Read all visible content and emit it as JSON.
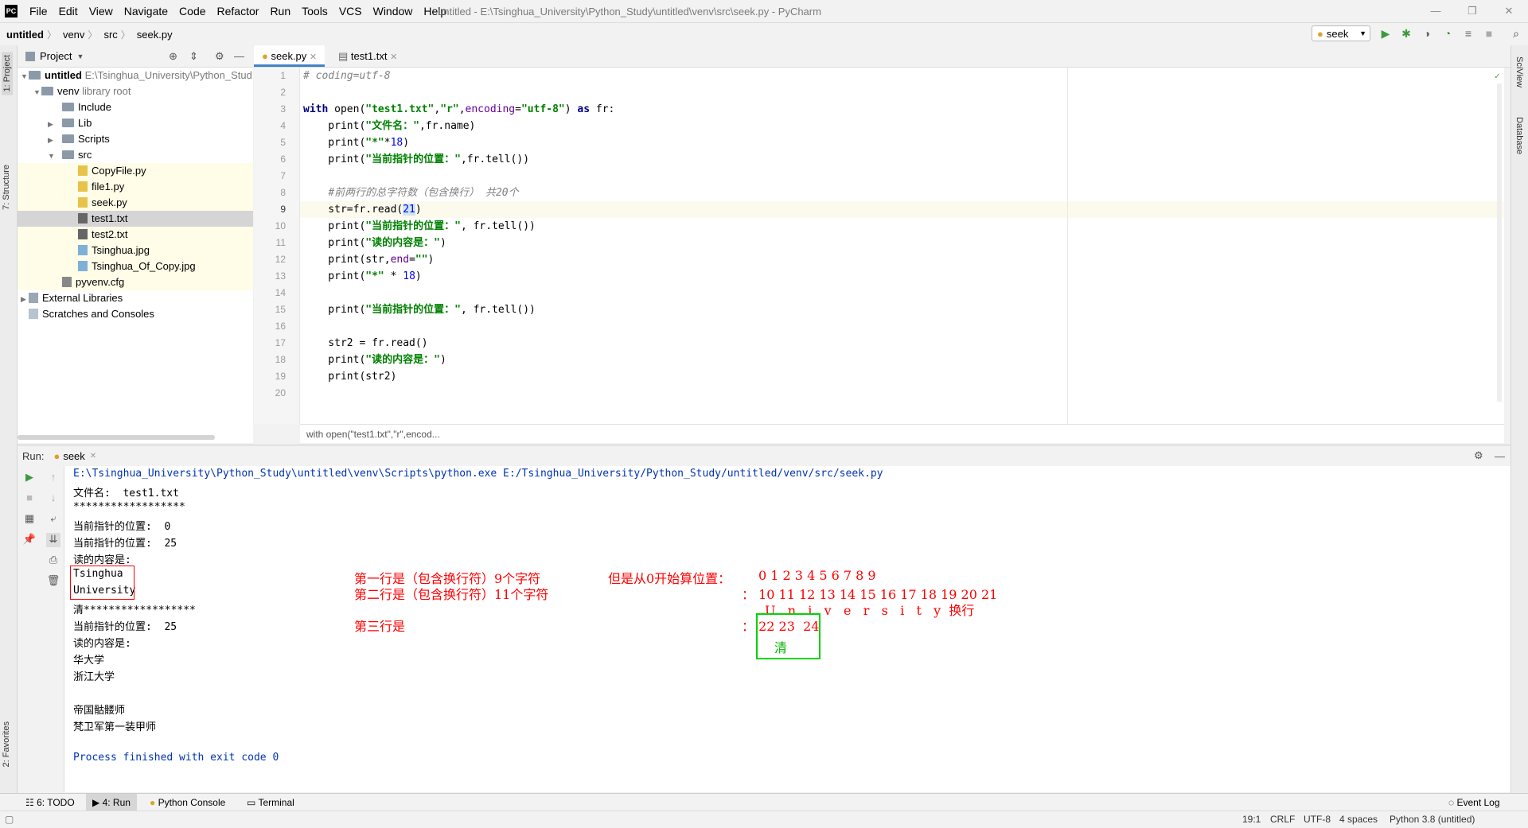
{
  "menu": {
    "items": [
      "File",
      "Edit",
      "View",
      "Navigate",
      "Code",
      "Refactor",
      "Run",
      "Tools",
      "VCS",
      "Window",
      "Help"
    ],
    "title": "untitled - E:\\Tsinghua_University\\Python_Study\\untitled\\venv\\src\\seek.py - PyCharm"
  },
  "nav": {
    "crumbs": [
      "untitled",
      "venv",
      "src",
      "seek.py"
    ],
    "run_config": "seek"
  },
  "left_strip": {
    "project": "1: Project",
    "structure": "7: Structure",
    "favorites": "2: Favorites"
  },
  "right_strip": {
    "sciview": "SciView",
    "database": "Database"
  },
  "project": {
    "header": "Project",
    "rows": [
      {
        "label": "untitled",
        "extra": "E:\\Tsinghua_University\\Python_Stud"
      },
      {
        "label": "venv",
        "extra": "library root"
      },
      {
        "label": "Include"
      },
      {
        "label": "Lib"
      },
      {
        "label": "Scripts"
      },
      {
        "label": "src"
      },
      {
        "label": "CopyFile.py"
      },
      {
        "label": "file1.py"
      },
      {
        "label": "seek.py"
      },
      {
        "label": "test1.txt"
      },
      {
        "label": "test2.txt"
      },
      {
        "label": "Tsinghua.jpg"
      },
      {
        "label": "Tsinghua_Of_Copy.jpg"
      },
      {
        "label": "pyvenv.cfg"
      },
      {
        "label": "External Libraries"
      },
      {
        "label": "Scratches and Consoles"
      }
    ]
  },
  "editor": {
    "tabs": [
      "seek.py",
      "test1.txt"
    ],
    "line_numbers": [
      "1",
      "2",
      "3",
      "4",
      "5",
      "6",
      "7",
      "8",
      "9",
      "10",
      "11",
      "12",
      "13",
      "14",
      "15",
      "16",
      "17",
      "18",
      "19",
      "20"
    ],
    "breadcrumb": "with open(\"test1.txt\",\"r\",encod..."
  },
  "run": {
    "label": "Run:",
    "tab": "seek",
    "output": [
      "E:\\Tsinghua_University\\Python_Study\\untitled\\venv\\Scripts\\python.exe E:/Tsinghua_University/Python_Study/untitled/venv/src/seek.py",
      "文件名:  test1.txt",
      "******************",
      "当前指针的位置:  0",
      "当前指针的位置:  25",
      "读的内容是:",
      "Tsinghua",
      "University",
      "清******************",
      "当前指针的位置:  25",
      "读的内容是:",
      "华大学",
      "浙江大学",
      "",
      "帝国骷髅师",
      "梵卫军第一装甲师",
      "",
      "Process finished with exit code 0"
    ],
    "annotations": {
      "line1": "第一行是（包含换行符）9个字符",
      "line1b": "但是从0开始算位置：",
      "line1_positions": "0 1 2 3 4 5 6 7 8 9",
      "line2": "第二行是（包含换行符）11个字符",
      "line2_positions": "： 10 11 12 13 14 15 16 17 18 19 20 21",
      "line2_letters": "U   n   i   v   e   r   s   i   t   y  换行",
      "line3": "第三行是",
      "line3_positions": "： 22 23  24",
      "box_char": "清"
    }
  },
  "bottom_tabs": [
    "6: TODO",
    "4: Run",
    "Python Console",
    "Terminal",
    "Event Log"
  ],
  "status": {
    "pos": "19:1",
    "eol": "CRLF",
    "enc": "UTF-8",
    "indent": "4 spaces",
    "interp": "Python 3.8 (untitled)"
  }
}
